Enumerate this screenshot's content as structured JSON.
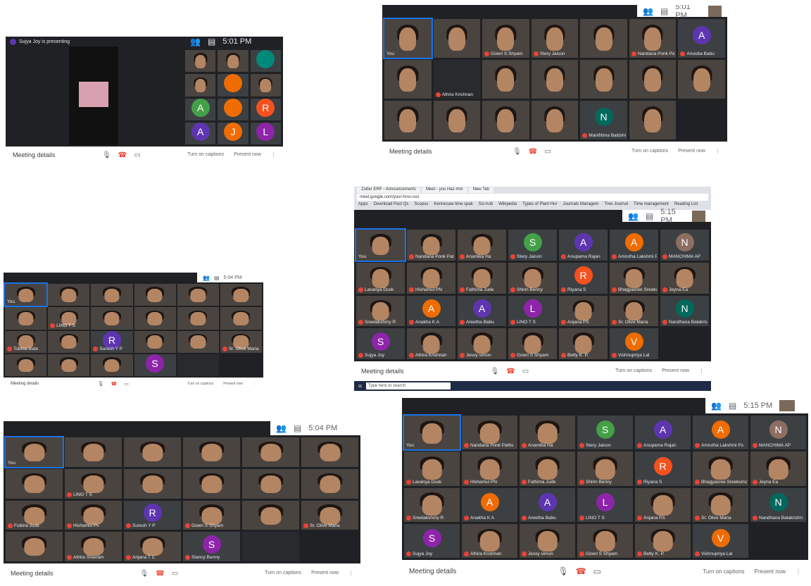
{
  "colors": {
    "meet_dark": "#202124",
    "mute_red": "#ea4335",
    "accent_blue": "#1a73e8"
  },
  "common": {
    "meeting_details": "Meeting details",
    "turn_on_captions": "Turn on captions",
    "present_now": "Present now",
    "you": "You"
  },
  "shots": [
    {
      "id": "s1",
      "time": "5:01 PM",
      "presenting_banner": "Sujya Joy is presenting",
      "tiles": [
        {
          "name": "",
          "kind": "video"
        },
        {
          "name": "",
          "kind": "video"
        },
        {
          "name": "",
          "kind": "avatar",
          "letter": "",
          "color": "#00897b"
        },
        {
          "name": "",
          "kind": "video"
        },
        {
          "name": "",
          "kind": "avatar",
          "letter": "",
          "color": "#ef6c00"
        },
        {
          "name": "",
          "kind": "video"
        },
        {
          "name": "",
          "kind": "avatar",
          "letter": "A",
          "color": "#43a047"
        },
        {
          "name": "",
          "kind": "avatar",
          "letter": "",
          "color": "#ef6c00"
        },
        {
          "name": "",
          "kind": "avatar",
          "letter": "R",
          "color": "#f4511e"
        },
        {
          "name": "",
          "kind": "avatar",
          "letter": "A",
          "color": "#5e35b1"
        },
        {
          "name": "",
          "kind": "avatar",
          "letter": "J",
          "color": "#ef6c00"
        },
        {
          "name": "",
          "kind": "avatar",
          "letter": "L",
          "color": "#8e24aa"
        }
      ]
    },
    {
      "id": "s2",
      "time": "5:01 PM",
      "tiles": [
        {
          "name": "You",
          "kind": "video"
        },
        {
          "name": "",
          "kind": "video"
        },
        {
          "name": "Gowri S Shyam",
          "kind": "video"
        },
        {
          "name": "Stery Jaison",
          "kind": "video"
        },
        {
          "name": "",
          "kind": "video"
        },
        {
          "name": "Nandana Ponk Paths",
          "kind": "video"
        },
        {
          "name": "Anooba Babu",
          "kind": "avatar",
          "letter": "A",
          "color": "#5e35b1"
        },
        {
          "name": "",
          "kind": "video"
        },
        {
          "name": "Athira Krishnan",
          "kind": "dark"
        },
        {
          "name": "",
          "kind": "video"
        },
        {
          "name": "",
          "kind": "video"
        },
        {
          "name": "",
          "kind": "video"
        },
        {
          "name": "",
          "kind": "video"
        },
        {
          "name": "",
          "kind": "video"
        },
        {
          "name": "",
          "kind": "video"
        },
        {
          "name": "",
          "kind": "video"
        },
        {
          "name": "",
          "kind": "video"
        },
        {
          "name": "",
          "kind": "video"
        },
        {
          "name": "Manifitima Baldshirin",
          "kind": "avatar",
          "letter": "N",
          "color": "#00695c"
        },
        {
          "name": "",
          "kind": "video"
        }
      ]
    },
    {
      "id": "s3",
      "time": "5:04 PM",
      "tiles": [
        {
          "name": "You",
          "kind": "video"
        },
        {
          "name": "",
          "kind": "video"
        },
        {
          "name": "",
          "kind": "video"
        },
        {
          "name": "",
          "kind": "video"
        },
        {
          "name": "",
          "kind": "video"
        },
        {
          "name": "",
          "kind": "video"
        },
        {
          "name": "",
          "kind": "video"
        },
        {
          "name": "LINO T S",
          "kind": "video"
        },
        {
          "name": "",
          "kind": "video"
        },
        {
          "name": "",
          "kind": "video"
        },
        {
          "name": "",
          "kind": "video"
        },
        {
          "name": "",
          "kind": "video"
        },
        {
          "name": "Tobina Jude",
          "kind": "video"
        },
        {
          "name": "",
          "kind": "video"
        },
        {
          "name": "Suresh Y P",
          "kind": "avatar",
          "letter": "R",
          "color": "#5e35b1"
        },
        {
          "name": "",
          "kind": "video"
        },
        {
          "name": "",
          "kind": "video"
        },
        {
          "name": "Sr. Olive Maria",
          "kind": "video"
        },
        {
          "name": "",
          "kind": "video"
        },
        {
          "name": "",
          "kind": "video"
        },
        {
          "name": "",
          "kind": "video"
        },
        {
          "name": "",
          "kind": "avatar",
          "letter": "S",
          "color": "#8e24aa"
        },
        {
          "name": "",
          "kind": "dark"
        }
      ]
    },
    {
      "id": "s4",
      "time": "5:15 PM",
      "browser_tabs": [
        "Zutter ERP - Announcements",
        "Meet - you Haz-mm",
        "New Tab"
      ],
      "url": "meet.google.com/your-hrus-oxx",
      "bookmarks": [
        "Apps",
        "Download Past Qs",
        "Scopus",
        "Kennesaw time spak",
        "Sci-hub",
        "Wikipedia",
        "Types of Plant Hor",
        "Journals Managem",
        "Tree Journal",
        "Time management",
        "Reading List"
      ],
      "taskbar_search": "Type here to search",
      "tiles": [
        {
          "name": "You",
          "kind": "video"
        },
        {
          "name": "Nandana Ponk Paths",
          "kind": "video"
        },
        {
          "name": "Anamika Ha",
          "kind": "video"
        },
        {
          "name": "Stery Jaison",
          "kind": "avatar",
          "letter": "S",
          "color": "#43a047"
        },
        {
          "name": "Anupama Rajan",
          "kind": "avatar",
          "letter": "A",
          "color": "#5e35b1"
        },
        {
          "name": "Amrutha Lakshmi Ps",
          "kind": "avatar",
          "letter": "A",
          "color": "#ef6c00"
        },
        {
          "name": "MANCHIMA AP",
          "kind": "avatar",
          "letter": "N",
          "color": "#8d6e63"
        },
        {
          "name": "Lavanya Dusk",
          "kind": "video"
        },
        {
          "name": "Hishamul PN",
          "kind": "video"
        },
        {
          "name": "Fathima Jude",
          "kind": "video"
        },
        {
          "name": "Shirin Benny",
          "kind": "video"
        },
        {
          "name": "Riyana S",
          "kind": "avatar",
          "letter": "R",
          "color": "#f4511e"
        },
        {
          "name": "Bhagyasree Sreekumar",
          "kind": "video"
        },
        {
          "name": "Jeyna Ea",
          "kind": "video"
        },
        {
          "name": "Sreelakshmy R",
          "kind": "video"
        },
        {
          "name": "Anakha K A",
          "kind": "avatar",
          "letter": "A",
          "color": "#ef6c00"
        },
        {
          "name": "Areetha Babu",
          "kind": "avatar",
          "letter": "A",
          "color": "#5e35b1"
        },
        {
          "name": "LINO T S",
          "kind": "avatar",
          "letter": "L",
          "color": "#8e24aa"
        },
        {
          "name": "Anjana PS",
          "kind": "video"
        },
        {
          "name": "Sr. Olive Maria",
          "kind": "video"
        },
        {
          "name": "Nandhana Balakrishn",
          "kind": "avatar",
          "letter": "N",
          "color": "#00695c"
        },
        {
          "name": "Sujya Joy",
          "kind": "avatar",
          "letter": "S",
          "color": "#8e24aa"
        },
        {
          "name": "Athira Krishnan",
          "kind": "video"
        },
        {
          "name": "Jessy simon",
          "kind": "video"
        },
        {
          "name": "Gowri S Shyam",
          "kind": "video"
        },
        {
          "name": "Betty K. P.",
          "kind": "video"
        },
        {
          "name": "Vishnupriya Lal",
          "kind": "avatar",
          "letter": "V",
          "color": "#ef6c00"
        }
      ]
    },
    {
      "id": "s5",
      "time": "5:04 PM",
      "tiles": [
        {
          "name": "You",
          "kind": "video"
        },
        {
          "name": "",
          "kind": "video"
        },
        {
          "name": "",
          "kind": "video"
        },
        {
          "name": "",
          "kind": "video"
        },
        {
          "name": "",
          "kind": "video"
        },
        {
          "name": "",
          "kind": "video"
        },
        {
          "name": "",
          "kind": "video"
        },
        {
          "name": "LINO T S",
          "kind": "video"
        },
        {
          "name": "",
          "kind": "video"
        },
        {
          "name": "",
          "kind": "video"
        },
        {
          "name": "",
          "kind": "video"
        },
        {
          "name": "",
          "kind": "video"
        },
        {
          "name": "Fobina Jude",
          "kind": "video"
        },
        {
          "name": "Hishamul Ps",
          "kind": "video"
        },
        {
          "name": "Suresh Y P",
          "kind": "avatar",
          "letter": "R",
          "color": "#5e35b1"
        },
        {
          "name": "Gowri S Shyam",
          "kind": "video"
        },
        {
          "name": "",
          "kind": "video"
        },
        {
          "name": "Sr. Olive Maria",
          "kind": "video"
        },
        {
          "name": "",
          "kind": "video"
        },
        {
          "name": "Athira Sreeram",
          "kind": "video"
        },
        {
          "name": "Anjana T C",
          "kind": "video"
        },
        {
          "name": "Stancy Benny",
          "kind": "avatar",
          "letter": "S",
          "color": "#8e24aa"
        },
        {
          "name": "",
          "kind": "dark"
        }
      ]
    },
    {
      "id": "s6",
      "time": "5:15 PM",
      "tiles": [
        {
          "name": "You",
          "kind": "video"
        },
        {
          "name": "Nandana Ponk Paths",
          "kind": "video"
        },
        {
          "name": "Anamika Ha",
          "kind": "video"
        },
        {
          "name": "Stery Jaison",
          "kind": "avatar",
          "letter": "S",
          "color": "#43a047"
        },
        {
          "name": "Anupama Rajan",
          "kind": "avatar",
          "letter": "A",
          "color": "#5e35b1"
        },
        {
          "name": "Amrutha Lakshmi Ps",
          "kind": "avatar",
          "letter": "A",
          "color": "#ef6c00"
        },
        {
          "name": "MANCHIMA AP",
          "kind": "avatar",
          "letter": "N",
          "color": "#8d6e63"
        },
        {
          "name": "Lavanya Dusk",
          "kind": "video"
        },
        {
          "name": "Hishamul PN",
          "kind": "video"
        },
        {
          "name": "Fathima Jude",
          "kind": "video"
        },
        {
          "name": "Shirin Benny",
          "kind": "video"
        },
        {
          "name": "Riyana S",
          "kind": "avatar",
          "letter": "R",
          "color": "#f4511e"
        },
        {
          "name": "Bhagyasree Sreekumar",
          "kind": "video"
        },
        {
          "name": "Jeyna Ea",
          "kind": "video"
        },
        {
          "name": "Sreelakshmy R",
          "kind": "video"
        },
        {
          "name": "Anakha K A",
          "kind": "avatar",
          "letter": "A",
          "color": "#ef6c00"
        },
        {
          "name": "Areetha Babu",
          "kind": "avatar",
          "letter": "A",
          "color": "#5e35b1"
        },
        {
          "name": "LINO T S",
          "kind": "avatar",
          "letter": "L",
          "color": "#8e24aa"
        },
        {
          "name": "Anjana PS",
          "kind": "video"
        },
        {
          "name": "Sr. Olive Maria",
          "kind": "video"
        },
        {
          "name": "Nandhana Balakrishn",
          "kind": "avatar",
          "letter": "N",
          "color": "#00695c"
        },
        {
          "name": "Sujya Joy",
          "kind": "avatar",
          "letter": "S",
          "color": "#8e24aa"
        },
        {
          "name": "Athira Krishnan",
          "kind": "video"
        },
        {
          "name": "Jessy simon",
          "kind": "video"
        },
        {
          "name": "Gowri S Shyam",
          "kind": "video"
        },
        {
          "name": "Betty K. P.",
          "kind": "video"
        },
        {
          "name": "Vishnupriya Lal",
          "kind": "avatar",
          "letter": "V",
          "color": "#ef6c00"
        }
      ]
    }
  ]
}
